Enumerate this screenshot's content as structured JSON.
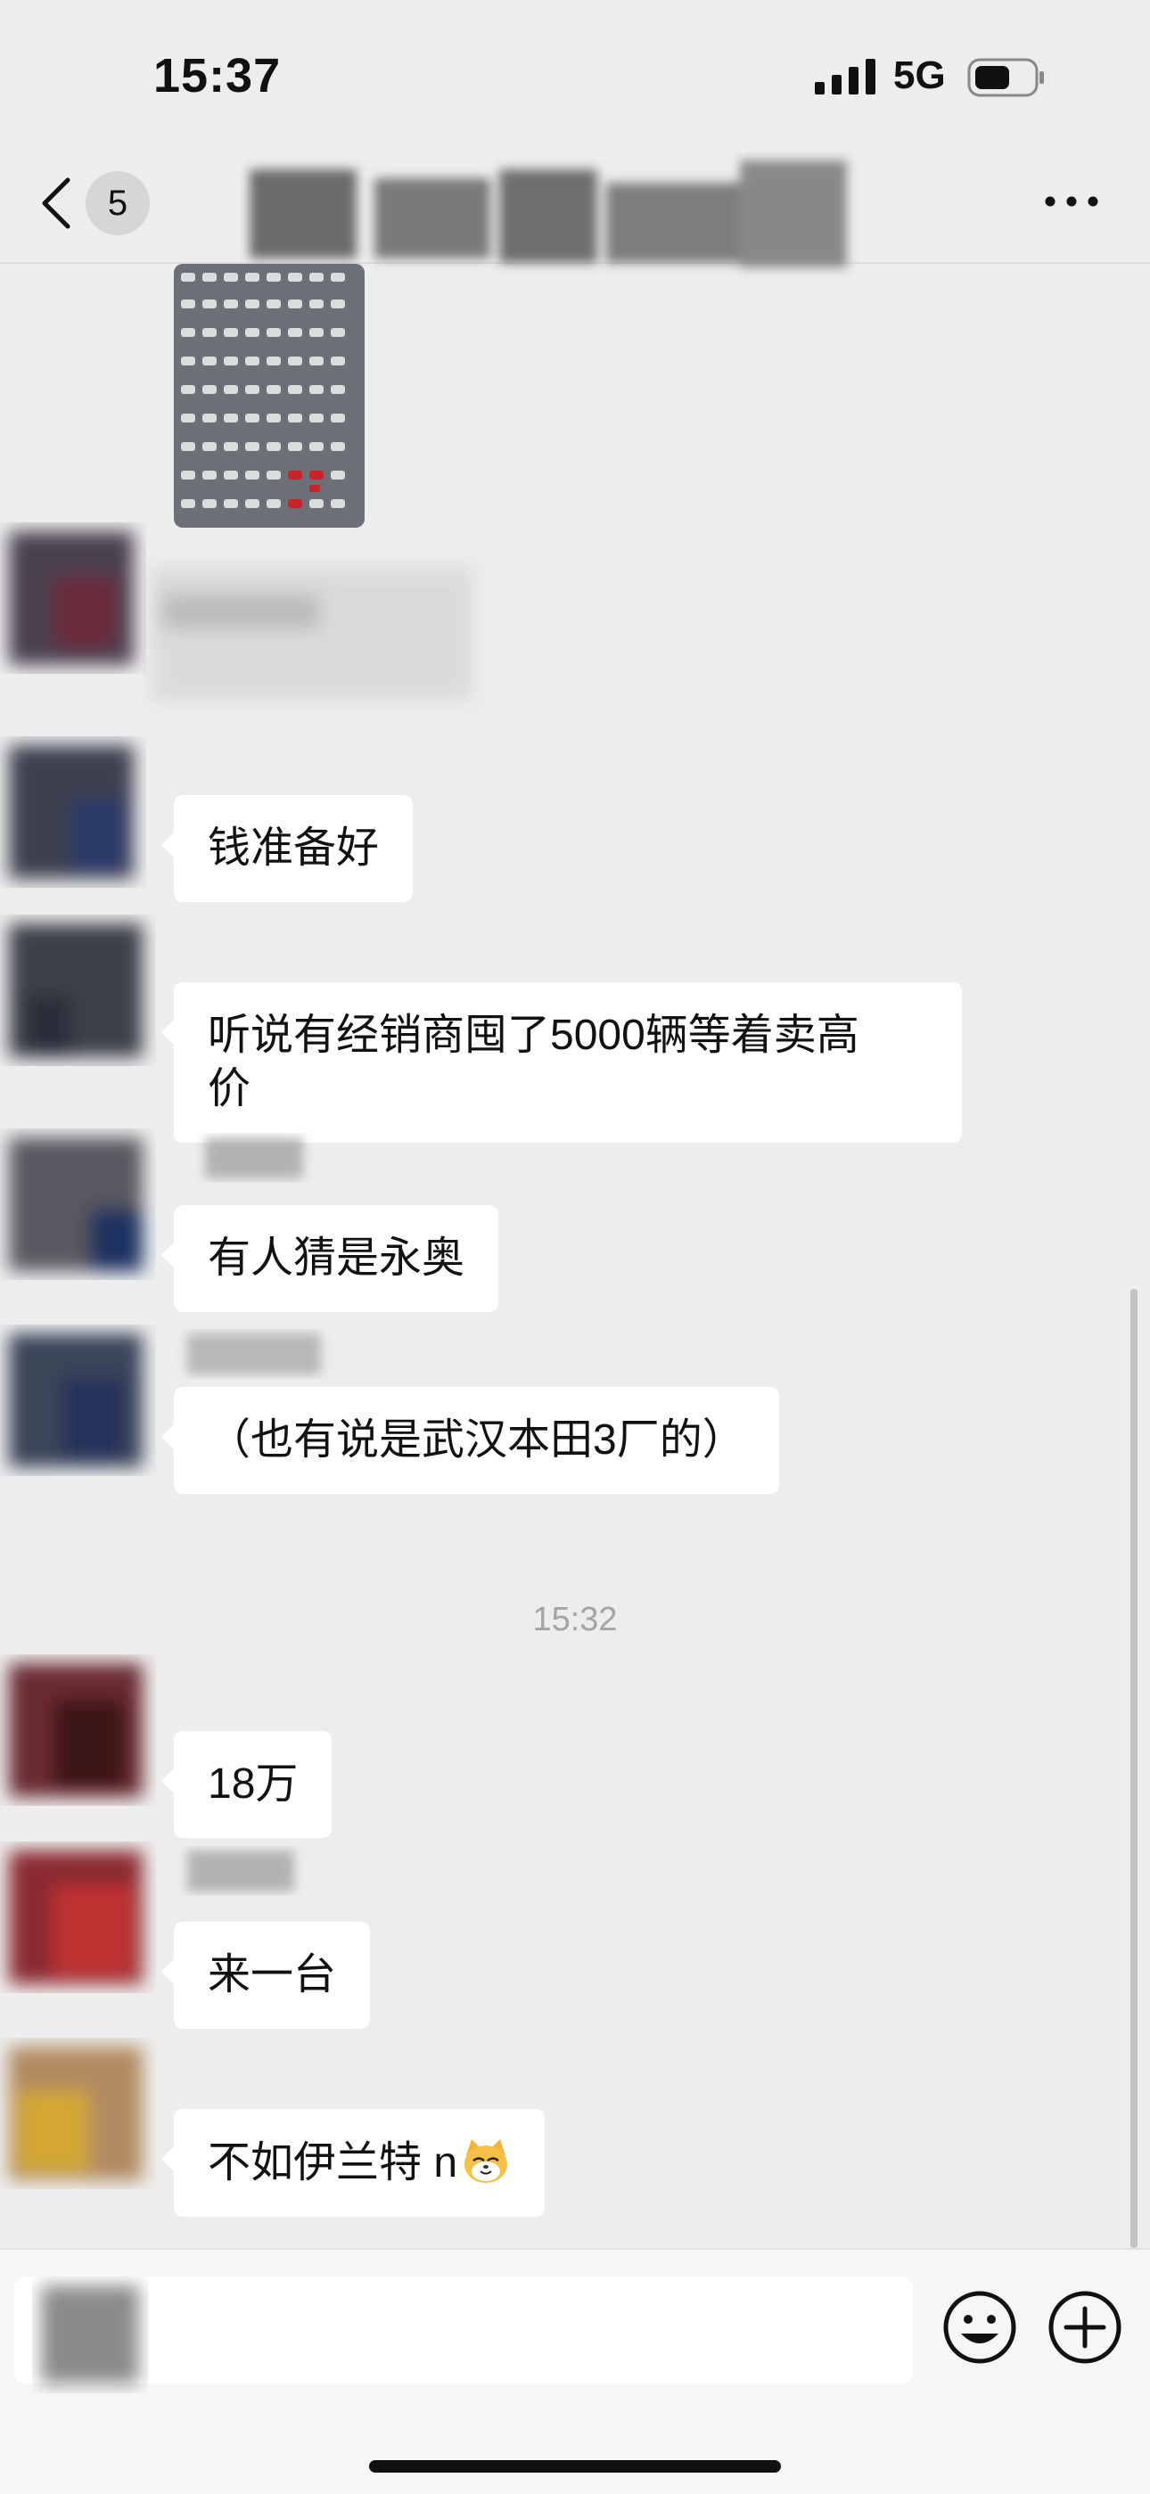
{
  "status_bar": {
    "time": "15:37",
    "network": "5G"
  },
  "nav": {
    "unread_count": "5"
  },
  "messages": [
    {
      "type": "image",
      "alt": "aerial parking lot of cars"
    },
    {
      "type": "text",
      "text": "钱准备好"
    },
    {
      "type": "text",
      "text": "听说有经销商囤了5000辆等着卖高\n价"
    },
    {
      "type": "text",
      "text": "有人猜是永奥"
    },
    {
      "type": "text",
      "text": "（也有说是武汉本田3厂的）"
    },
    {
      "type": "timestamp",
      "text": "15:32"
    },
    {
      "type": "text",
      "text": "18万"
    },
    {
      "type": "text",
      "text": "来一台"
    },
    {
      "type": "text",
      "text": "不如伊兰特 n",
      "emoji": "cat-face-emoji"
    }
  ],
  "input_bar": {
    "input_value": "",
    "emoji_icon": "smile-icon",
    "plus_icon": "plus-circle-icon"
  },
  "colors": {
    "background": "#ededed",
    "bubble": "#ffffff",
    "timestamp": "#a4a4a4"
  }
}
